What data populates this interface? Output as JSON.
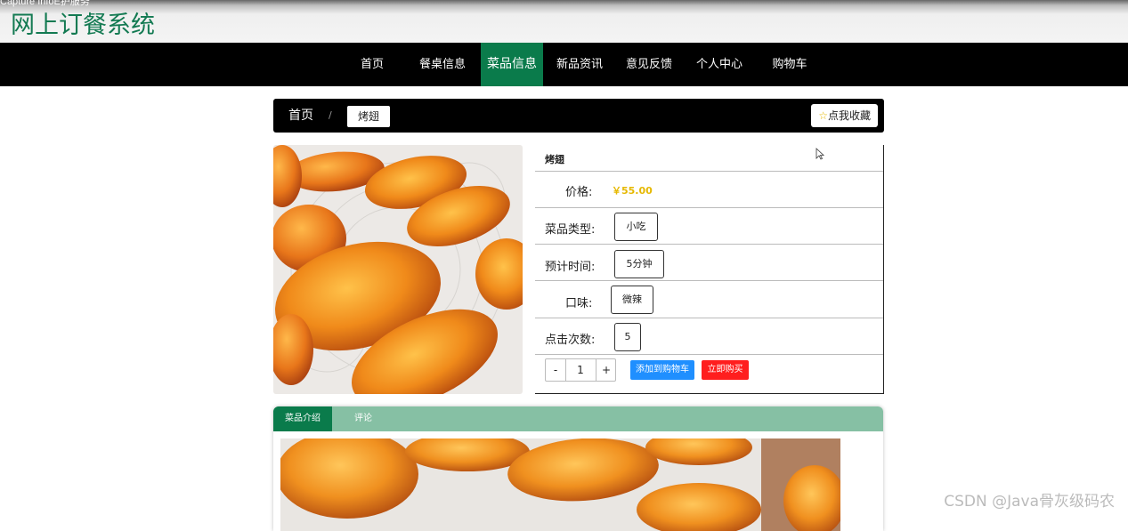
{
  "window": {
    "overlay_title": "Capture InfoE护服务"
  },
  "site": {
    "title": "网上订餐系统"
  },
  "nav": {
    "items": [
      "首页",
      "餐桌信息",
      "菜品信息",
      "新品资讯",
      "意见反馈",
      "个人中心",
      "购物车"
    ],
    "active_index": 2
  },
  "breadcrumb": {
    "home": "首页",
    "separator": "/",
    "current": "烤翅"
  },
  "favorite": {
    "icon": "star-icon",
    "label": "点我收藏"
  },
  "dish": {
    "name": "烤翅",
    "price_label": "价格:",
    "price": "￥55.00",
    "category_label": "菜品类型:",
    "category": "小吃",
    "time_label": "预计时间:",
    "time": "5分钟",
    "flavor_label": "口味:",
    "flavor": "微辣",
    "clicks_label": "点击次数:",
    "clicks": "5"
  },
  "purchase": {
    "minus": "-",
    "quantity": "1",
    "plus": "+",
    "add_to_cart": "添加到购物车",
    "buy_now": "立即购买"
  },
  "tabs": {
    "items": [
      "菜品介绍",
      "评论"
    ],
    "active_index": 0
  },
  "watermark": "CSDN @Java骨灰级码农",
  "colors": {
    "brand_green": "#0a7b4b",
    "tab_strip": "#86c0a4",
    "price": "#e6b800",
    "cart_button": "#1f8fff",
    "buy_button": "#ff1e1e"
  }
}
